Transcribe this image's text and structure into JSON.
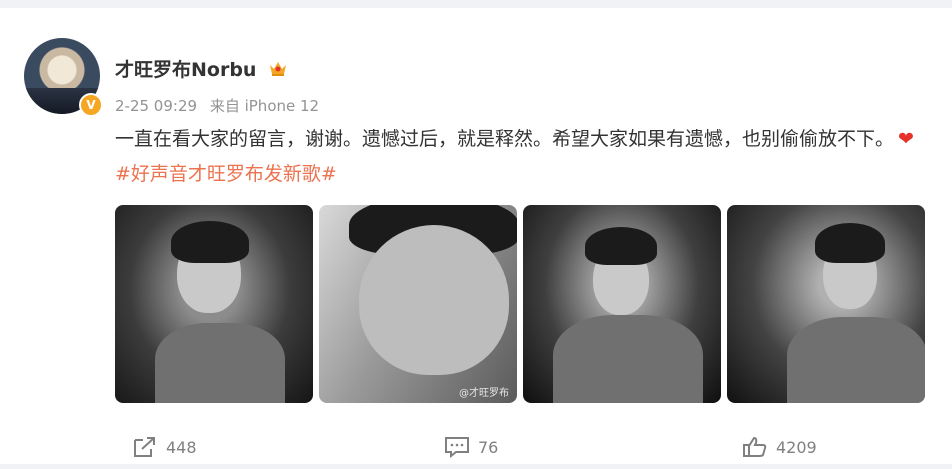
{
  "post": {
    "username": "才旺罗布Norbu",
    "time": "2-25 09:29",
    "source": "来自 iPhone 12",
    "text": "一直在看大家的留言，谢谢。遗憾过后，就是释然。希望大家如果有遗憾，也别偷偷放不下。",
    "hashtag": "#好声音才旺罗布发新歌#",
    "photo_watermark": "@才旺罗布"
  },
  "actions": {
    "repost_count": "448",
    "comment_count": "76",
    "like_count": "4209"
  },
  "colors": {
    "hashtag": "#eb7350",
    "verified_badge": "#f5a623",
    "heart": "#e5322d"
  }
}
